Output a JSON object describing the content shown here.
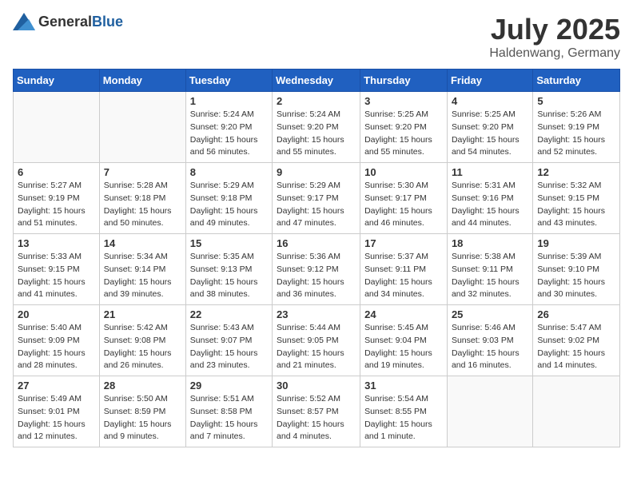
{
  "header": {
    "logo_general": "General",
    "logo_blue": "Blue",
    "month": "July 2025",
    "location": "Haldenwang, Germany"
  },
  "days_of_week": [
    "Sunday",
    "Monday",
    "Tuesday",
    "Wednesday",
    "Thursday",
    "Friday",
    "Saturday"
  ],
  "weeks": [
    [
      {
        "day": "",
        "info": ""
      },
      {
        "day": "",
        "info": ""
      },
      {
        "day": "1",
        "info": "Sunrise: 5:24 AM\nSunset: 9:20 PM\nDaylight: 15 hours\nand 56 minutes."
      },
      {
        "day": "2",
        "info": "Sunrise: 5:24 AM\nSunset: 9:20 PM\nDaylight: 15 hours\nand 55 minutes."
      },
      {
        "day": "3",
        "info": "Sunrise: 5:25 AM\nSunset: 9:20 PM\nDaylight: 15 hours\nand 55 minutes."
      },
      {
        "day": "4",
        "info": "Sunrise: 5:25 AM\nSunset: 9:20 PM\nDaylight: 15 hours\nand 54 minutes."
      },
      {
        "day": "5",
        "info": "Sunrise: 5:26 AM\nSunset: 9:19 PM\nDaylight: 15 hours\nand 52 minutes."
      }
    ],
    [
      {
        "day": "6",
        "info": "Sunrise: 5:27 AM\nSunset: 9:19 PM\nDaylight: 15 hours\nand 51 minutes."
      },
      {
        "day": "7",
        "info": "Sunrise: 5:28 AM\nSunset: 9:18 PM\nDaylight: 15 hours\nand 50 minutes."
      },
      {
        "day": "8",
        "info": "Sunrise: 5:29 AM\nSunset: 9:18 PM\nDaylight: 15 hours\nand 49 minutes."
      },
      {
        "day": "9",
        "info": "Sunrise: 5:29 AM\nSunset: 9:17 PM\nDaylight: 15 hours\nand 47 minutes."
      },
      {
        "day": "10",
        "info": "Sunrise: 5:30 AM\nSunset: 9:17 PM\nDaylight: 15 hours\nand 46 minutes."
      },
      {
        "day": "11",
        "info": "Sunrise: 5:31 AM\nSunset: 9:16 PM\nDaylight: 15 hours\nand 44 minutes."
      },
      {
        "day": "12",
        "info": "Sunrise: 5:32 AM\nSunset: 9:15 PM\nDaylight: 15 hours\nand 43 minutes."
      }
    ],
    [
      {
        "day": "13",
        "info": "Sunrise: 5:33 AM\nSunset: 9:15 PM\nDaylight: 15 hours\nand 41 minutes."
      },
      {
        "day": "14",
        "info": "Sunrise: 5:34 AM\nSunset: 9:14 PM\nDaylight: 15 hours\nand 39 minutes."
      },
      {
        "day": "15",
        "info": "Sunrise: 5:35 AM\nSunset: 9:13 PM\nDaylight: 15 hours\nand 38 minutes."
      },
      {
        "day": "16",
        "info": "Sunrise: 5:36 AM\nSunset: 9:12 PM\nDaylight: 15 hours\nand 36 minutes."
      },
      {
        "day": "17",
        "info": "Sunrise: 5:37 AM\nSunset: 9:11 PM\nDaylight: 15 hours\nand 34 minutes."
      },
      {
        "day": "18",
        "info": "Sunrise: 5:38 AM\nSunset: 9:11 PM\nDaylight: 15 hours\nand 32 minutes."
      },
      {
        "day": "19",
        "info": "Sunrise: 5:39 AM\nSunset: 9:10 PM\nDaylight: 15 hours\nand 30 minutes."
      }
    ],
    [
      {
        "day": "20",
        "info": "Sunrise: 5:40 AM\nSunset: 9:09 PM\nDaylight: 15 hours\nand 28 minutes."
      },
      {
        "day": "21",
        "info": "Sunrise: 5:42 AM\nSunset: 9:08 PM\nDaylight: 15 hours\nand 26 minutes."
      },
      {
        "day": "22",
        "info": "Sunrise: 5:43 AM\nSunset: 9:07 PM\nDaylight: 15 hours\nand 23 minutes."
      },
      {
        "day": "23",
        "info": "Sunrise: 5:44 AM\nSunset: 9:05 PM\nDaylight: 15 hours\nand 21 minutes."
      },
      {
        "day": "24",
        "info": "Sunrise: 5:45 AM\nSunset: 9:04 PM\nDaylight: 15 hours\nand 19 minutes."
      },
      {
        "day": "25",
        "info": "Sunrise: 5:46 AM\nSunset: 9:03 PM\nDaylight: 15 hours\nand 16 minutes."
      },
      {
        "day": "26",
        "info": "Sunrise: 5:47 AM\nSunset: 9:02 PM\nDaylight: 15 hours\nand 14 minutes."
      }
    ],
    [
      {
        "day": "27",
        "info": "Sunrise: 5:49 AM\nSunset: 9:01 PM\nDaylight: 15 hours\nand 12 minutes."
      },
      {
        "day": "28",
        "info": "Sunrise: 5:50 AM\nSunset: 8:59 PM\nDaylight: 15 hours\nand 9 minutes."
      },
      {
        "day": "29",
        "info": "Sunrise: 5:51 AM\nSunset: 8:58 PM\nDaylight: 15 hours\nand 7 minutes."
      },
      {
        "day": "30",
        "info": "Sunrise: 5:52 AM\nSunset: 8:57 PM\nDaylight: 15 hours\nand 4 minutes."
      },
      {
        "day": "31",
        "info": "Sunrise: 5:54 AM\nSunset: 8:55 PM\nDaylight: 15 hours\nand 1 minute."
      },
      {
        "day": "",
        "info": ""
      },
      {
        "day": "",
        "info": ""
      }
    ]
  ]
}
